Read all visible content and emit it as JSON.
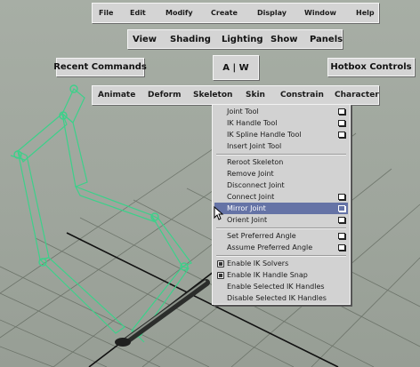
{
  "colors": {
    "viewport": "#a3aaa1",
    "joint_green": "#3dd08a",
    "panel_gray": "#d4d4d4",
    "menu_highlight": "#6573a6"
  },
  "main_menu": {
    "items": [
      "File",
      "Edit",
      "Modify",
      "Create",
      "Display",
      "Window",
      "Help"
    ]
  },
  "panel_menu": {
    "items": [
      "View",
      "Shading",
      "Lighting",
      "Show",
      "Panels"
    ]
  },
  "buttons": {
    "recent_commands": "Recent Commands",
    "aw": "A | W",
    "hotbox_controls": "Hotbox Controls"
  },
  "module_menu": {
    "items": [
      "Animate",
      "Deform",
      "Skeleton",
      "Skin",
      "Constrain",
      "Character"
    ]
  },
  "skeleton_menu": {
    "items": [
      {
        "label": "Joint Tool",
        "option": true
      },
      {
        "label": "IK Handle Tool",
        "option": true
      },
      {
        "label": "IK Spline Handle Tool",
        "option": true
      },
      {
        "label": "Insert Joint Tool",
        "option": false
      },
      {
        "label": "Reroot Skeleton",
        "option": false
      },
      {
        "label": "Remove Joint",
        "option": false
      },
      {
        "label": "Disconnect Joint",
        "option": false
      },
      {
        "label": "Connect Joint",
        "option": true
      },
      {
        "label": "Mirror Joint",
        "option": true,
        "highlighted": true
      },
      {
        "label": "Orient Joint",
        "option": true
      },
      {
        "label": "Set Preferred Angle",
        "option": true
      },
      {
        "label": "Assume Preferred Angle",
        "option": true
      },
      {
        "label": "Enable IK Solvers",
        "checkbox": true
      },
      {
        "label": "Enable IK Handle Snap",
        "checkbox": true
      },
      {
        "label": "Enable Selected IK Handles",
        "option": false
      },
      {
        "label": "Disable Selected IK Handles",
        "option": false
      }
    ]
  }
}
